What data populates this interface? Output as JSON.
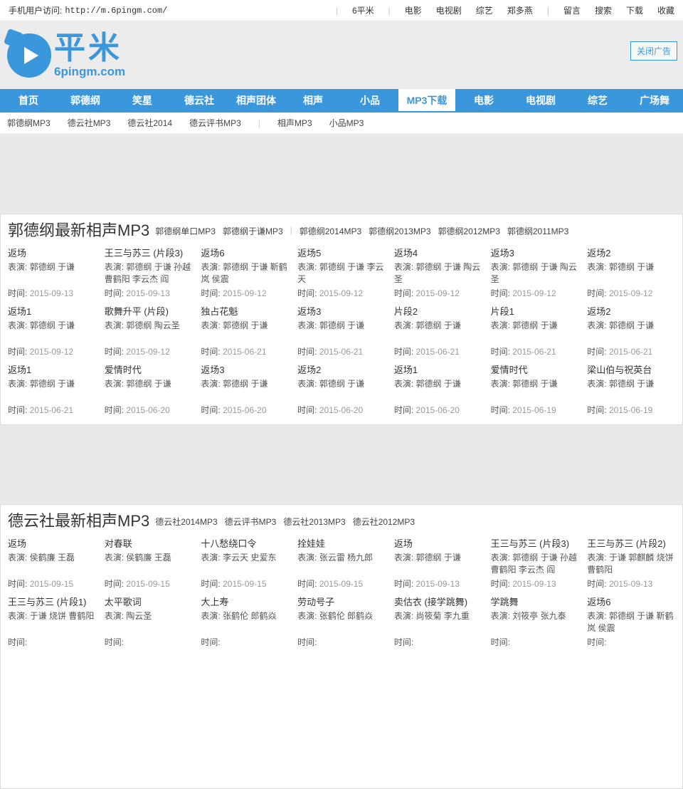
{
  "colors": {
    "accent": "#3b97dc"
  },
  "topbar": {
    "mobile_label": "手机用户访问:",
    "mobile_url": "http://m.6pingm.com/",
    "links": [
      "|",
      "6平米",
      "|",
      "电影",
      "电视剧",
      "综艺",
      "郑多燕",
      "|",
      "留言",
      "搜索",
      "下载",
      "收藏"
    ]
  },
  "header": {
    "logo_cn": "平米",
    "logo_domain": "6pingm.com",
    "close_ad_label": "关闭广告"
  },
  "nav": {
    "items": [
      {
        "label": "首页",
        "active": false
      },
      {
        "label": "郭德纲",
        "active": false
      },
      {
        "label": "笑星",
        "active": false
      },
      {
        "label": "德云社",
        "active": false
      },
      {
        "label": "相声团体",
        "active": false
      },
      {
        "label": "相声",
        "active": false
      },
      {
        "label": "小品",
        "active": false
      },
      {
        "label": "MP3下载",
        "active": true
      },
      {
        "label": "电影",
        "active": false
      },
      {
        "label": "电视剧",
        "active": false
      },
      {
        "label": "综艺",
        "active": false
      },
      {
        "label": "广场舞",
        "active": false
      }
    ]
  },
  "subnav": {
    "links": [
      "郭德纲MP3",
      "德云社MP3",
      "德云社2014",
      "德云评书MP3",
      "|",
      "相声MP3",
      "小品MP3"
    ]
  },
  "labels": {
    "cast": "表演:",
    "date": "时间:"
  },
  "sections": [
    {
      "title": "郭德纲最新相声MP3",
      "links": [
        "郭德纲单口MP3",
        "郭德纲于谦MP3",
        "|",
        "郭德纲2014MP3",
        "郭德纲2013MP3",
        "郭德纲2012MP3",
        "郭德纲2011MP3"
      ],
      "items": [
        {
          "title": "返场",
          "cast": "郭德纲 于谦",
          "date": "2015-09-13"
        },
        {
          "title": "王三与苏三 (片段3)",
          "cast": "郭德纲 于谦 孙越 曹鹤阳 李云杰 阎",
          "date": "2015-09-13"
        },
        {
          "title": "返场6",
          "cast": "郭德纲 于谦 靳鹤岚 侯震",
          "date": "2015-09-12"
        },
        {
          "title": "返场5",
          "cast": "郭德纲 于谦 李云天",
          "date": "2015-09-12"
        },
        {
          "title": "返场4",
          "cast": "郭德纲 于谦 陶云圣",
          "date": "2015-09-12"
        },
        {
          "title": "返场3",
          "cast": "郭德纲 于谦 陶云圣",
          "date": "2015-09-12"
        },
        {
          "title": "返场2",
          "cast": "郭德纲 于谦",
          "date": "2015-09-12"
        },
        {
          "title": "返场1",
          "cast": "郭德纲 于谦",
          "date": "2015-09-12"
        },
        {
          "title": "歌舞升平 (片段)",
          "cast": "郭德纲 陶云圣",
          "date": "2015-09-12"
        },
        {
          "title": "独占花魁",
          "cast": "郭德纲 于谦",
          "date": "2015-06-21"
        },
        {
          "title": "返场3",
          "cast": "郭德纲 于谦",
          "date": "2015-06-21"
        },
        {
          "title": "片段2",
          "cast": "郭德纲 于谦",
          "date": "2015-06-21"
        },
        {
          "title": "片段1",
          "cast": "郭德纲 于谦",
          "date": "2015-06-21"
        },
        {
          "title": "返场2",
          "cast": "郭德纲 于谦",
          "date": "2015-06-21"
        },
        {
          "title": "返场1",
          "cast": "郭德纲 于谦",
          "date": "2015-06-21"
        },
        {
          "title": "爱情时代",
          "cast": "郭德纲 于谦",
          "date": "2015-06-20"
        },
        {
          "title": "返场3",
          "cast": "郭德纲 于谦",
          "date": "2015-06-20"
        },
        {
          "title": "返场2",
          "cast": "郭德纲 于谦",
          "date": "2015-06-20"
        },
        {
          "title": "返场1",
          "cast": "郭德纲 于谦",
          "date": "2015-06-20"
        },
        {
          "title": "爱情时代",
          "cast": "郭德纲 于谦",
          "date": "2015-06-19"
        },
        {
          "title": "梁山伯与祝英台",
          "cast": "郭德纲 于谦",
          "date": "2015-06-19"
        }
      ]
    },
    {
      "title": "德云社最新相声MP3",
      "links": [
        "德云社2014MP3",
        "德云评书MP3",
        "德云社2013MP3",
        "德云社2012MP3"
      ],
      "items": [
        {
          "title": "返场",
          "cast": "侯鹤廉 王磊",
          "date": "2015-09-15"
        },
        {
          "title": "对春联",
          "cast": "侯鹤廉 王磊",
          "date": "2015-09-15"
        },
        {
          "title": "十八愁绕口令",
          "cast": "李云天 史爱东",
          "date": "2015-09-15"
        },
        {
          "title": "拴娃娃",
          "cast": "张云雷 杨九郎",
          "date": "2015-09-15"
        },
        {
          "title": "返场",
          "cast": "郭德纲 于谦",
          "date": "2015-09-13"
        },
        {
          "title": "王三与苏三 (片段3)",
          "cast": "郭德纲 于谦 孙越 曹鹤阳 李云杰 阎",
          "date": "2015-09-13"
        },
        {
          "title": "王三与苏三 (片段2)",
          "cast": "于谦 郭麒麟 烧饼 曹鹤阳",
          "date": "2015-09-13"
        },
        {
          "title": "王三与苏三 (片段1)",
          "cast": "于谦 烧饼 曹鹤阳",
          "date": ""
        },
        {
          "title": "太平歌词",
          "cast": "陶云圣",
          "date": ""
        },
        {
          "title": "大上寿",
          "cast": "张鹤伦 郎鹤焱",
          "date": ""
        },
        {
          "title": "劳动号子",
          "cast": "张鹤伦 郎鹤焱",
          "date": ""
        },
        {
          "title": "卖估衣 (接学跳舞)",
          "cast": "尚筱菊 李九重",
          "date": ""
        },
        {
          "title": "学跳舞",
          "cast": "刘筱亭 张九泰",
          "date": ""
        },
        {
          "title": "返场6",
          "cast": "郭德纲 于谦 靳鹤岚 侯震",
          "date": ""
        }
      ]
    }
  ]
}
